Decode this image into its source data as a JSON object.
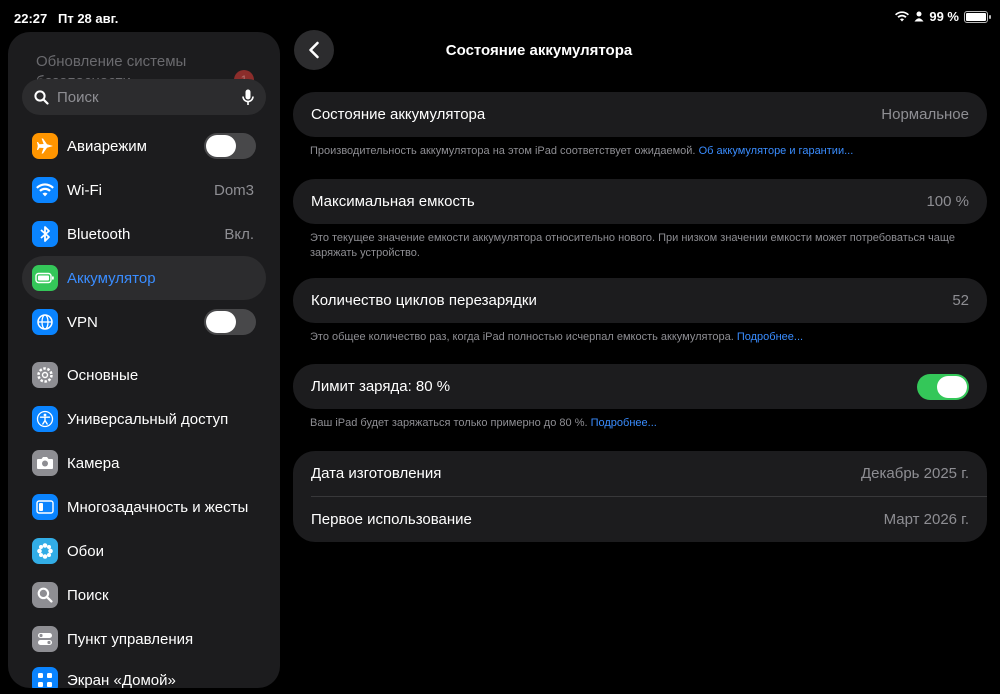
{
  "status_bar": {
    "time": "22:27",
    "date": "Пт 28 авг.",
    "battery": "99 %"
  },
  "sidebar": {
    "update_banner": "Обновление системы безопасности",
    "update_badge": "1",
    "search_placeholder": "Поиск",
    "items": [
      {
        "label": "Авиарежим",
        "icon": "airplane-icon",
        "color": "#ff9500",
        "toggle": false
      },
      {
        "label": "Wi-Fi",
        "icon": "wifi-icon",
        "color": "#0a84ff",
        "value": "Dom3"
      },
      {
        "label": "Bluetooth",
        "icon": "bluetooth-icon",
        "color": "#0a84ff",
        "value": "Вкл."
      },
      {
        "label": "Аккумулятор",
        "icon": "battery-icon",
        "color": "#34c759",
        "active": true
      },
      {
        "label": "VPN",
        "icon": "globe-icon",
        "color": "#0a84ff",
        "toggle": false
      },
      {
        "label": "Основные",
        "icon": "gear-icon",
        "color": "#8e8e93"
      },
      {
        "label": "Универсальный доступ",
        "icon": "accessibility-icon",
        "color": "#0a84ff"
      },
      {
        "label": "Камера",
        "icon": "camera-icon",
        "color": "#8e8e93"
      },
      {
        "label": "Многозадачность и жесты",
        "icon": "multitasking-icon",
        "color": "#0a84ff"
      },
      {
        "label": "Обои",
        "icon": "wallpaper-icon",
        "color": "#32ade6"
      },
      {
        "label": "Поиск",
        "icon": "search-icon",
        "color": "#8e8e93"
      },
      {
        "label": "Пункт управления",
        "icon": "control-center-icon",
        "color": "#8e8e93"
      },
      {
        "label": "Экран «Домой»",
        "icon": "home-screen-icon",
        "color": "#0a84ff"
      }
    ]
  },
  "main": {
    "title": "Состояние аккумулятора",
    "health": {
      "label": "Состояние аккумулятора",
      "value": "Нормальное",
      "note": "Производительность аккумулятора на этом iPad соответствует ожидаемой.",
      "note_link": "Об аккумуляторе и гарантии..."
    },
    "capacity": {
      "label": "Максимальная емкость",
      "value": "100 %",
      "note": "Это текущее значение емкости аккумулятора относительно нового. При низком значении емкости может потребоваться чаще заряжать устройство."
    },
    "cycles": {
      "label": "Количество циклов перезарядки",
      "value": "52",
      "note": "Это общее количество раз, когда iPad полностью исчерпал емкость аккумулятора.",
      "note_link": "Подробнее..."
    },
    "charge_limit": {
      "label": "Лимит заряда: 80 %",
      "enabled": true,
      "note": "Ваш iPad будет заряжаться только примерно до 80 %.",
      "note_link": "Подробнее..."
    },
    "dates": {
      "manufacture_label": "Дата изготовления",
      "manufacture_value": "Декабрь 2025 г.",
      "first_use_label": "Первое использование",
      "first_use_value": "Март 2026 г."
    }
  },
  "colors": {
    "accent": "#3a8dff",
    "toggle_on": "#34c759"
  }
}
